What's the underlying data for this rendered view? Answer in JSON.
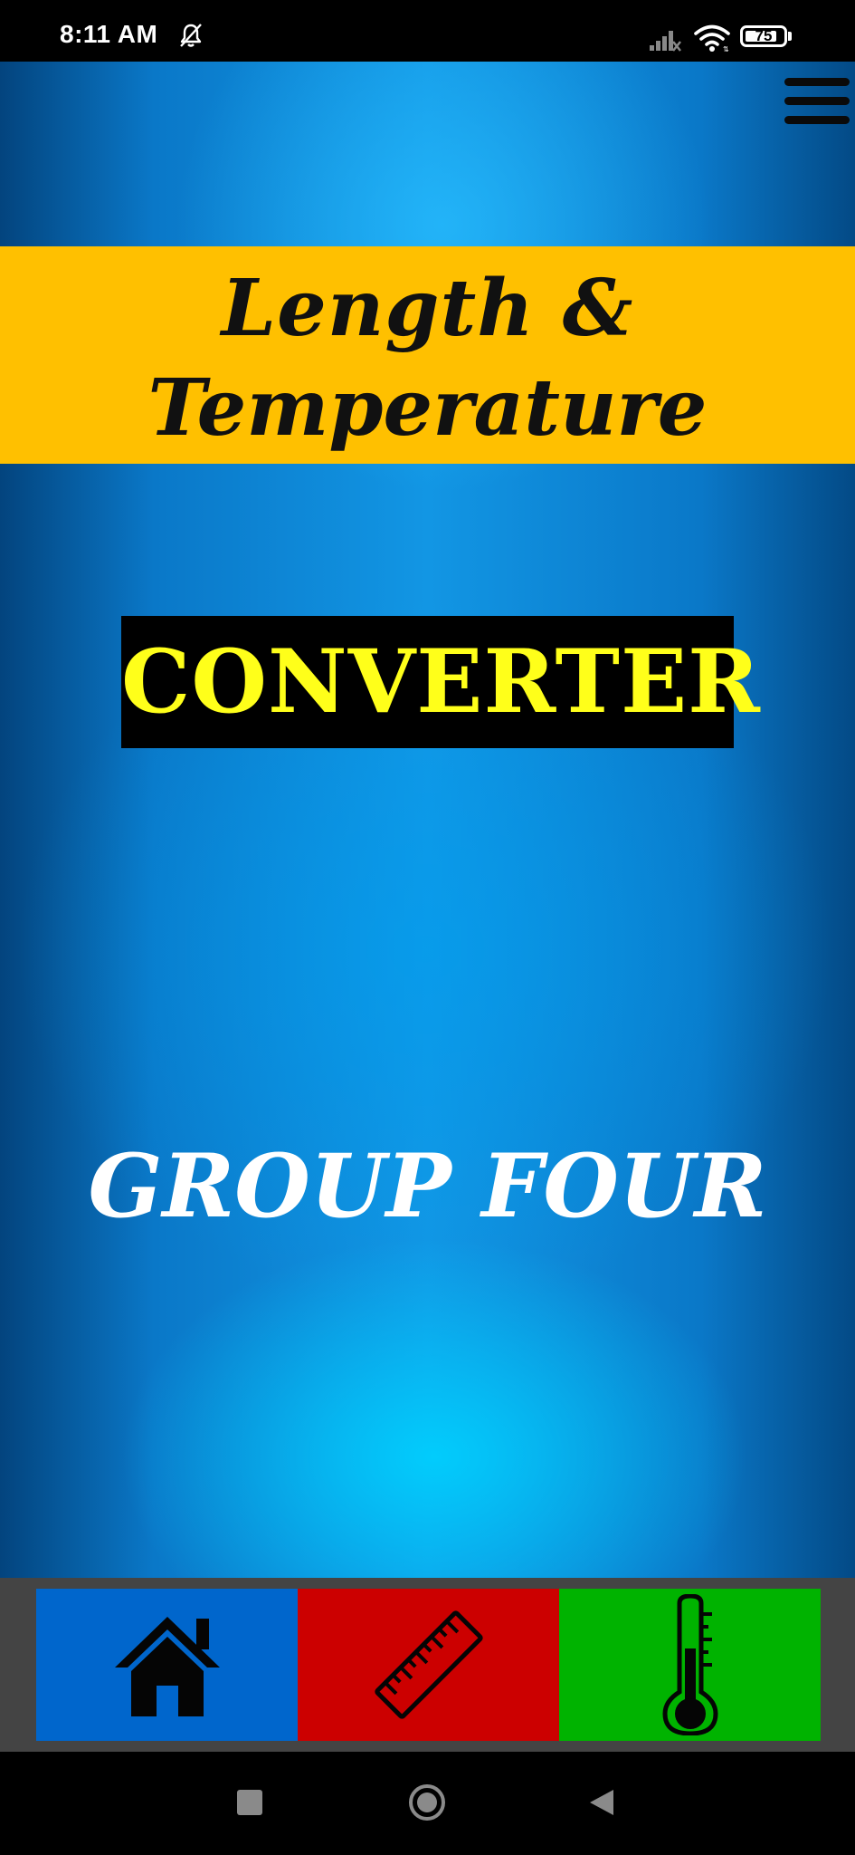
{
  "status_bar": {
    "time": "8:11 AM",
    "battery_level": "75",
    "icons": [
      "bell-off-icon",
      "signal-icon",
      "wifi-icon",
      "battery-icon"
    ]
  },
  "header": {
    "menu_icon": "hamburger-menu-icon"
  },
  "title": {
    "line1": "Length &",
    "line2": "Temperature"
  },
  "subtitle": "CONVERTER",
  "group": "GROUP FOUR",
  "bottom_nav": {
    "items": [
      {
        "icon": "home-icon",
        "color": "#0066cc"
      },
      {
        "icon": "ruler-icon",
        "color": "#cc0000"
      },
      {
        "icon": "thermometer-icon",
        "color": "#00b300"
      }
    ]
  },
  "system_nav": {
    "icons": [
      "recent-apps-icon",
      "home-circle-icon",
      "back-icon"
    ]
  },
  "colors": {
    "banner": "#ffc000",
    "converter_text": "#ffff1a",
    "converter_bg": "#000000",
    "background_blue": "#1296e4"
  }
}
